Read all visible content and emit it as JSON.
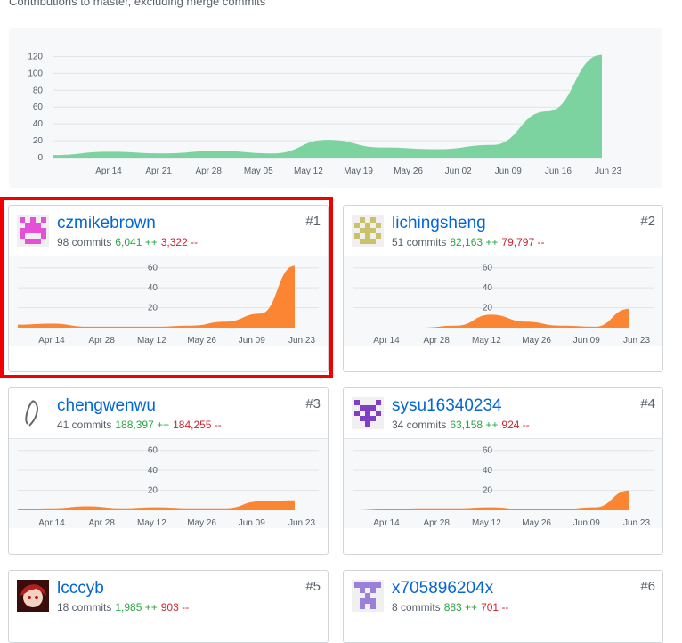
{
  "subtitle": "Contributions to master, excluding merge commits",
  "colors": {
    "main_area": "#7dd3a0",
    "user_area": "#fb8532",
    "link": "#0366d6",
    "additions": "#28a745",
    "deletions": "#cb2431",
    "highlight": "#f00000"
  },
  "chart_data": [
    {
      "type": "area",
      "title": "",
      "x": [
        "Apr 14",
        "Apr 21",
        "Apr 28",
        "May 05",
        "May 12",
        "May 19",
        "May 26",
        "Jun 02",
        "Jun 09",
        "Jun 16",
        "Jun 23"
      ],
      "xlabels": [
        "Apr 14",
        "Apr 21",
        "Apr 28",
        "May 05",
        "May 12",
        "May 19",
        "May 26",
        "Jun 02",
        "Jun 09",
        "Jun 16",
        "Jun 23"
      ],
      "series": [
        {
          "values": [
            3,
            7,
            5,
            8,
            5,
            21,
            12,
            10,
            15,
            55,
            122
          ]
        }
      ],
      "yticks": [
        "0",
        "20",
        "40",
        "60",
        "80",
        "100",
        "120"
      ],
      "ylim": [
        0,
        130
      ],
      "grid": true
    }
  ],
  "contributors": [
    {
      "rank": "#1",
      "username": "czmikebrown",
      "commits": "98 commits",
      "additions": "6,041 ++",
      "deletions": "3,322 --",
      "avatar": "identicon-pink",
      "chart": {
        "type": "area",
        "xlabels": [
          "Apr 14",
          "Apr 28",
          "May 12",
          "May 26",
          "Jun 09",
          "Jun 23"
        ],
        "yticks": [
          "20",
          "40",
          "60"
        ],
        "ylim": [
          0,
          66
        ],
        "values": [
          3,
          4,
          1,
          1,
          1,
          2,
          6,
          14,
          62
        ]
      }
    },
    {
      "rank": "#2",
      "username": "lichingsheng",
      "commits": "51 commits",
      "additions": "82,163 ++",
      "deletions": "79,797 --",
      "avatar": "identicon-olive",
      "chart": {
        "type": "area",
        "xlabels": [
          "Apr 14",
          "Apr 28",
          "May 12",
          "May 26",
          "Jun 09",
          "Jun 23"
        ],
        "yticks": [
          "20",
          "40",
          "60"
        ],
        "ylim": [
          0,
          66
        ],
        "values": [
          0,
          0,
          0,
          2,
          13,
          6,
          2,
          1,
          19
        ]
      }
    },
    {
      "rank": "#3",
      "username": "chengwenwu",
      "commits": "41 commits",
      "additions": "188,397 ++",
      "deletions": "184,255 --",
      "avatar": "photo-sketch",
      "chart": {
        "type": "area",
        "xlabels": [
          "Apr 14",
          "Apr 28",
          "May 12",
          "May 26",
          "Jun 09",
          "Jun 23"
        ],
        "yticks": [
          "20",
          "40",
          "60"
        ],
        "ylim": [
          0,
          66
        ],
        "values": [
          1,
          2,
          4,
          2,
          3,
          2,
          2,
          9,
          10
        ]
      }
    },
    {
      "rank": "#4",
      "username": "sysu16340234",
      "commits": "34 commits",
      "additions": "63,158 ++",
      "deletions": "924 --",
      "avatar": "identicon-purple",
      "chart": {
        "type": "area",
        "xlabels": [
          "Apr 14",
          "Apr 28",
          "May 12",
          "May 26",
          "Jun 09",
          "Jun 23"
        ],
        "yticks": [
          "20",
          "40",
          "60"
        ],
        "ylim": [
          0,
          66
        ],
        "values": [
          0,
          1,
          2,
          2,
          3,
          1,
          1,
          3,
          20
        ]
      }
    },
    {
      "rank": "#5",
      "username": "lcccyb",
      "commits": "18 commits",
      "additions": "1,985 ++",
      "deletions": "903 --",
      "avatar": "photo-anime"
    },
    {
      "rank": "#6",
      "username": "x705896204x",
      "commits": "8 commits",
      "additions": "883 ++",
      "deletions": "701 --",
      "avatar": "identicon-lavender"
    }
  ]
}
